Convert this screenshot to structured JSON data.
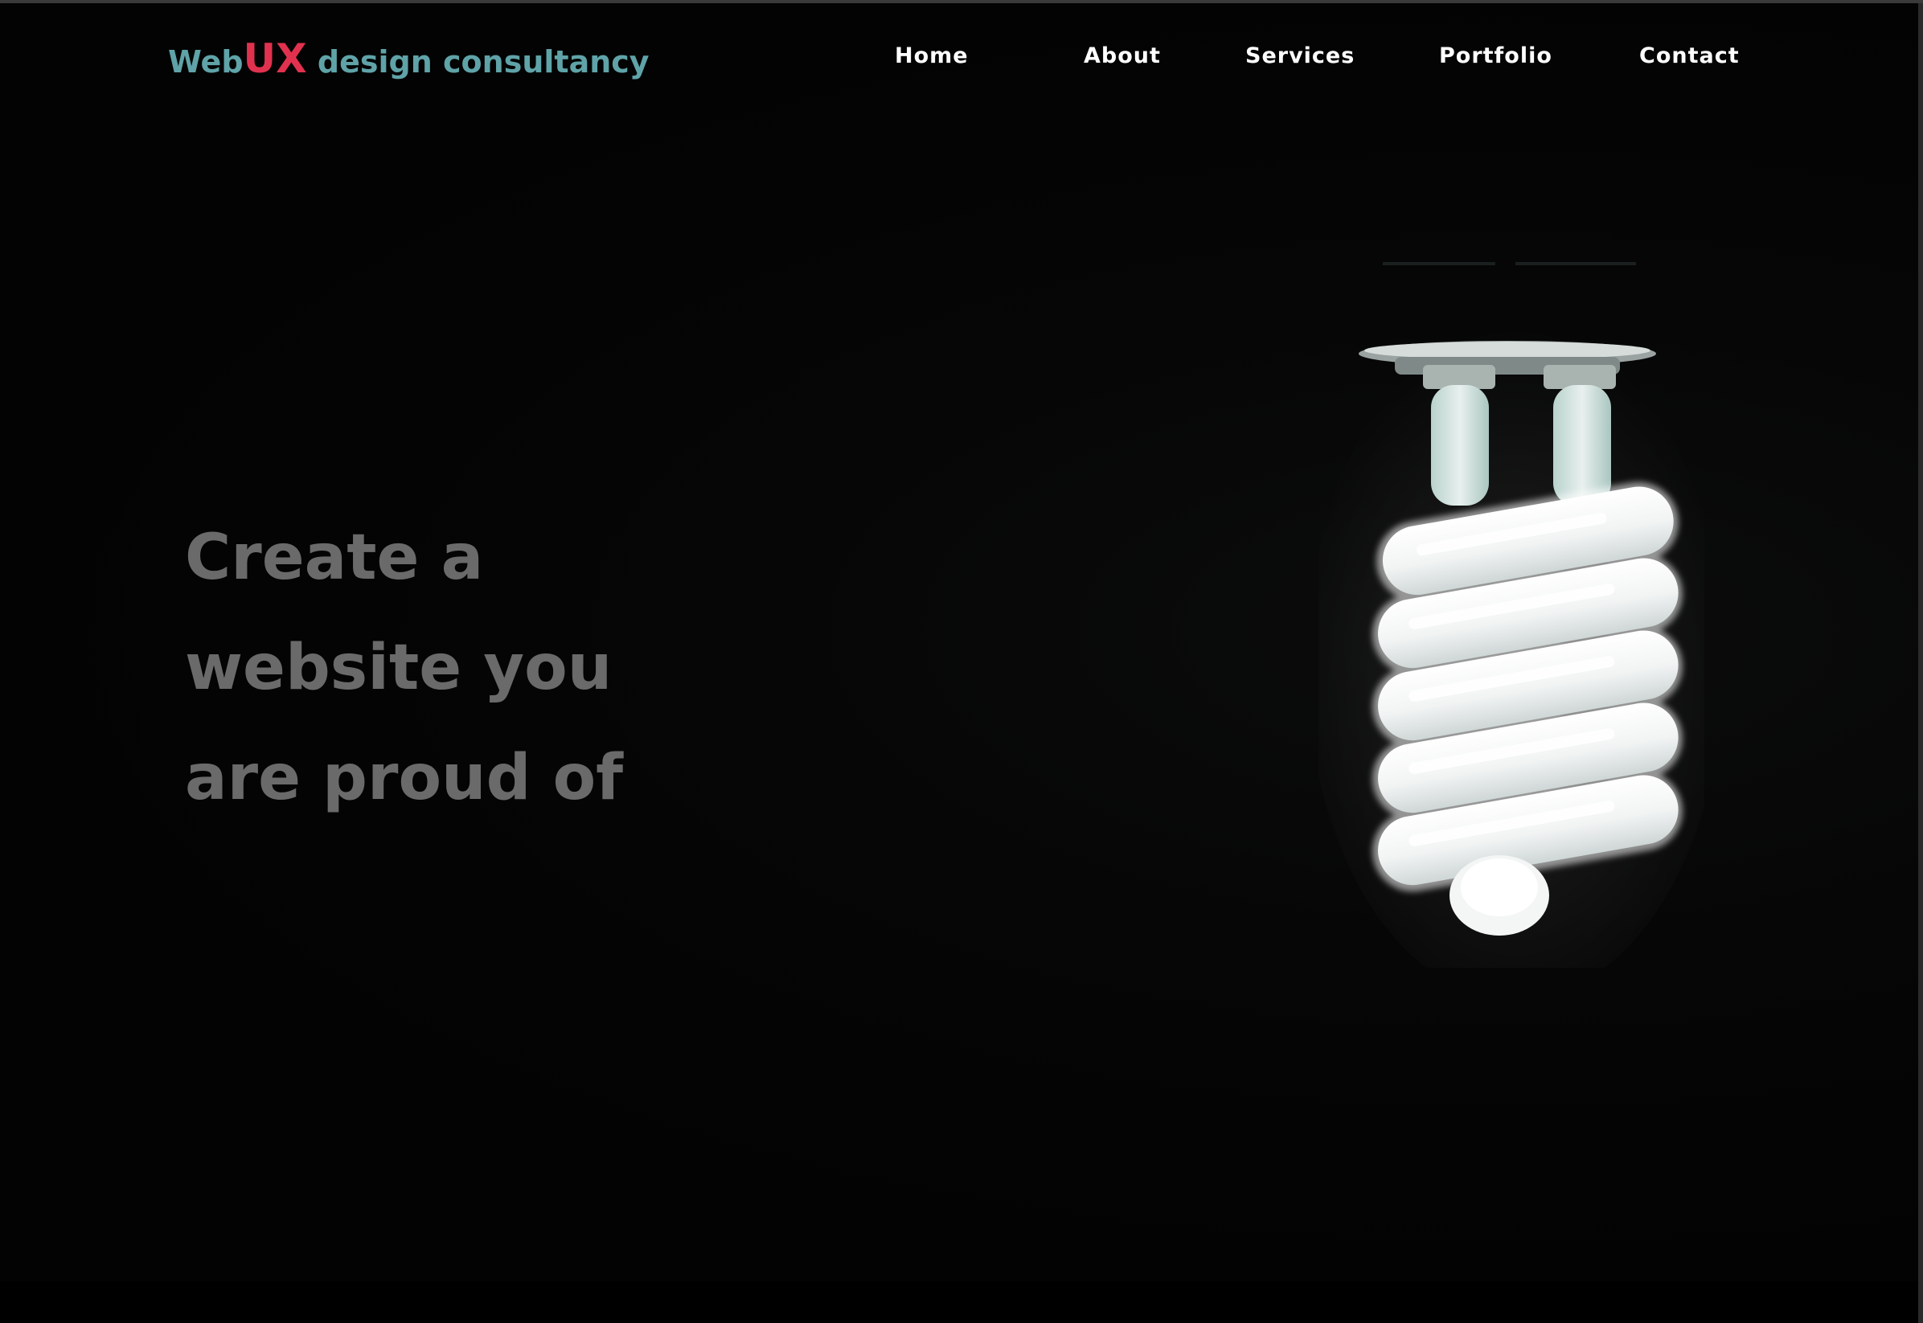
{
  "logo": {
    "part1": "Web",
    "part2": "UX",
    "part3": " design consultancy",
    "colors": {
      "primary": "#5fa3a8",
      "accent": "#e0324f"
    }
  },
  "nav": {
    "items": [
      {
        "label": "Home"
      },
      {
        "label": "About"
      },
      {
        "label": "Services"
      },
      {
        "label": "Portfolio"
      },
      {
        "label": "Contact"
      }
    ]
  },
  "hero": {
    "headline_lines": [
      "Create a",
      "website you",
      "are proud of"
    ],
    "image": "lightbulb-image"
  }
}
